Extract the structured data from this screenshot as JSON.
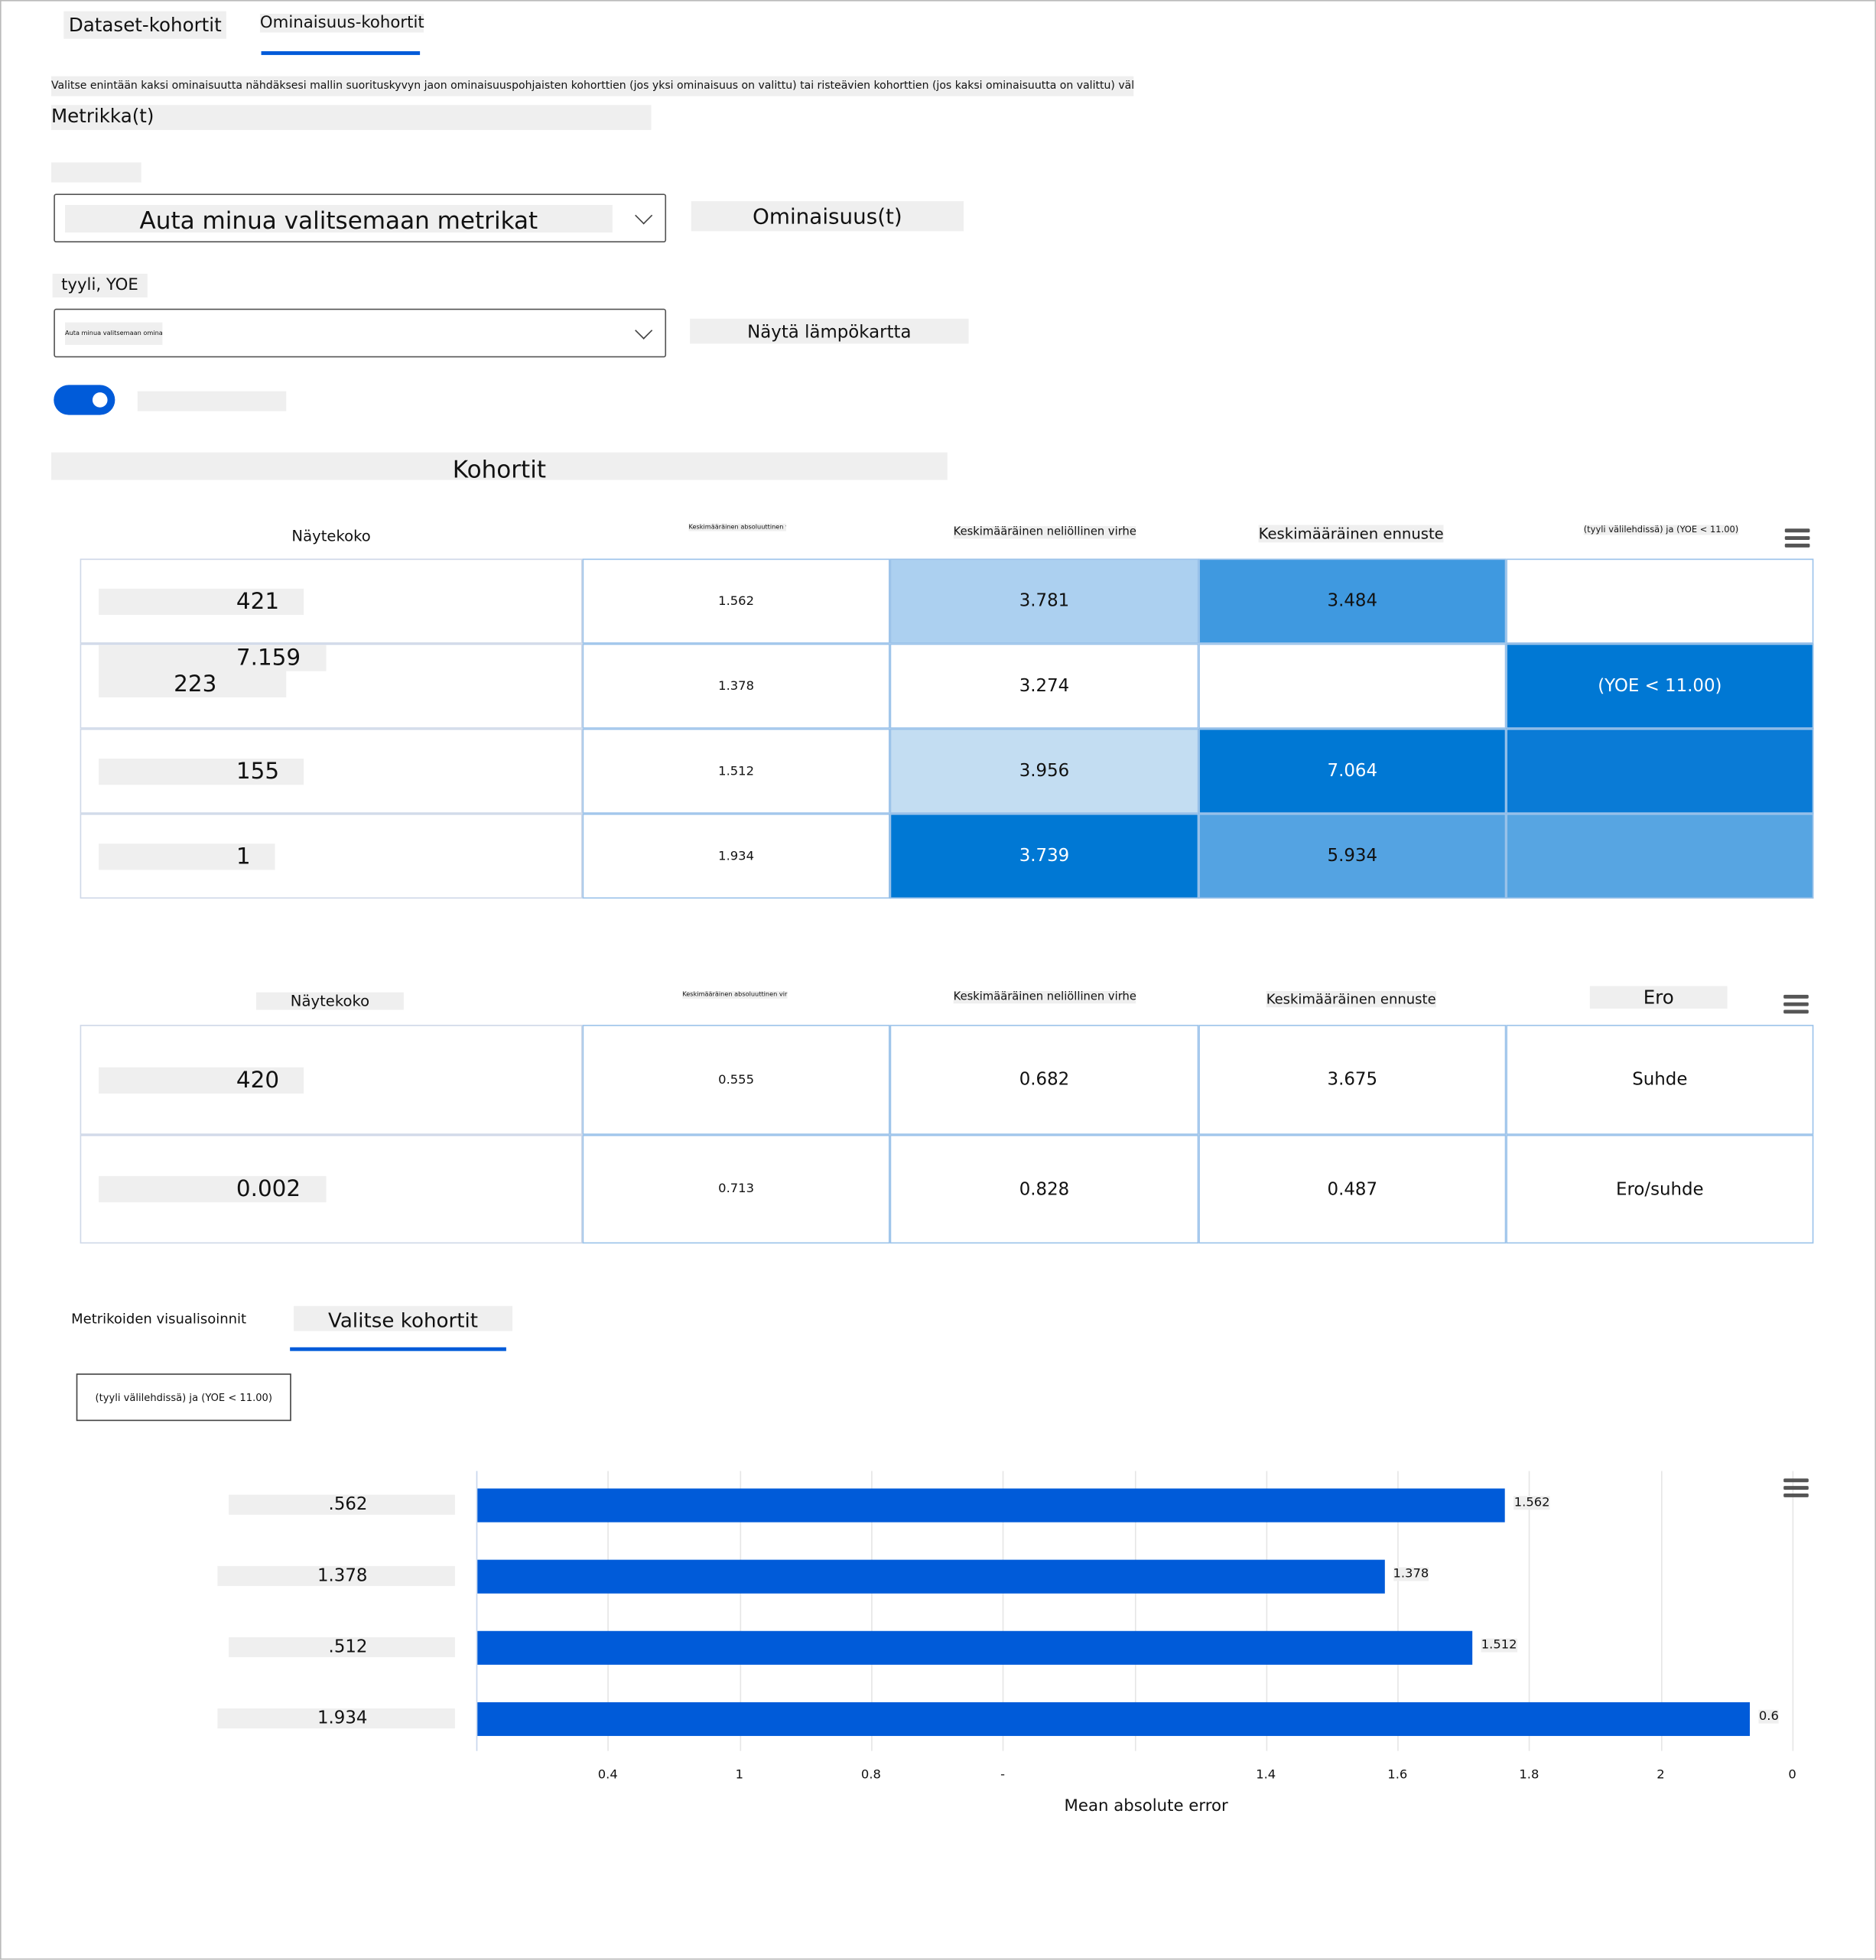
{
  "tabs": [
    {
      "label": "Dataset-kohortit",
      "active": false
    },
    {
      "label": "Ominaisuus-kohortit",
      "active": true
    }
  ],
  "description": "Valitse enintään kaksi ominaisuutta nähdäksesi mallin suorituskyvyn jaon ominaisuuspohjaisten kohorttien (jos yksi ominaisuus on valittu) tai risteävien kohorttien (jos kaksi ominaisuutta on valittu) välillä.",
  "metrics": {
    "label": "Metrikka(t)",
    "dropdown_value": "Auta minua valitsemaan metrikat"
  },
  "features": {
    "label": "Ominaisuus(t)",
    "selected_label": "tyyli, YOE",
    "dropdown_placeholder": "Auta minua valitsemaan ominaisuudet"
  },
  "heatmap_toggle": {
    "label": "Näytä lämpökartta",
    "on": true
  },
  "cohorts_title": "Kohortit",
  "accent_color": "#005bd9",
  "table1": {
    "headers": [
      "Näytekoko",
      "Keskimääräinen absoluuttinen virhe",
      "Keskimääräinen neliöllinen virhe",
      "Keskimääräinen ennuste",
      "(tyyli välilehdissä) ja (YOE < 11.00)"
    ],
    "rows": [
      {
        "cells": [
          "421",
          "1.562",
          "3.781",
          "3.484",
          ""
        ],
        "colors": [
          "#fff",
          "#fff",
          "#acd0f0",
          "#3f99e0",
          "#fff"
        ]
      },
      {
        "cells": [
          "7.159",
          "1.378",
          "3.274",
          "",
          "(YOE < 11.00)"
        ],
        "extra": "223",
        "colors": [
          "#fff",
          "#fff",
          "#fff",
          "#fff",
          "#0078d4"
        ]
      },
      {
        "cells": [
          "155",
          "1.512",
          "3.956",
          "7.064",
          ""
        ],
        "colors": [
          "#fff",
          "#fff",
          "#c3ddf2",
          "#0078d4",
          "#0a7bd6"
        ]
      },
      {
        "cells": [
          "1",
          "1.934",
          "3.739",
          "5.934",
          ""
        ],
        "colors": [
          "#fff",
          "#fff",
          "#0078d4",
          "#54a3e2",
          "#57a5e2"
        ]
      }
    ]
  },
  "table2": {
    "headers": [
      "Näytekoko",
      "Keskimääräinen absoluuttinen virhe",
      "Keskimääräinen neliöllinen virhe",
      "Keskimääräinen ennuste",
      "Ero"
    ],
    "rows": [
      {
        "cells": [
          "420",
          "0.555",
          "0.682",
          "3.675",
          "Suhde"
        ]
      },
      {
        "cells": [
          "0.002",
          "0.713",
          "0.828",
          "0.487",
          "Ero/suhde"
        ]
      }
    ]
  },
  "viz_tabs": [
    {
      "label": "Metrikoiden visualisoinnit",
      "active": false
    },
    {
      "label": "Valitse kohortit",
      "active": true
    }
  ],
  "cohort_button": "(tyyli välilehdissä) ja (YOE < 11.00)",
  "chart_data": {
    "type": "bar",
    "orientation": "horizontal",
    "categories": [
      ".562",
      "1.378",
      ".512",
      "1.934"
    ],
    "values": [
      1.562,
      1.378,
      1.512,
      1.934
    ],
    "value_labels": [
      "1.562",
      "1.378",
      "1.512",
      "0.6"
    ],
    "xlabel": "Mean absolute error",
    "xlim": [
      0,
      2
    ],
    "tick_labels": [
      "",
      "0.4",
      "1",
      "0.8",
      "-",
      "",
      "1.4",
      "1.6",
      "1.8",
      "2",
      "0"
    ],
    "grid": true,
    "bar_color": "#005bd9"
  }
}
